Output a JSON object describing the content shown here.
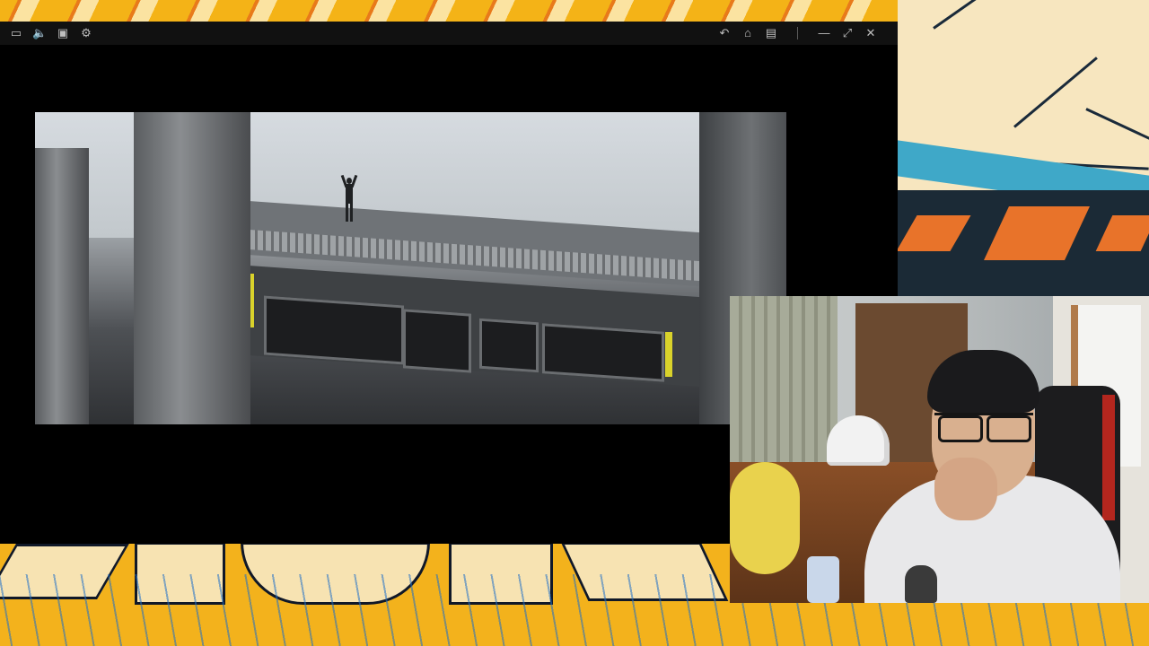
{
  "player": {
    "left_controls": [
      {
        "name": "screen-mode-icon",
        "glyph": "▭"
      },
      {
        "name": "volume-icon",
        "glyph": "🔈"
      },
      {
        "name": "subtitle-icon",
        "glyph": "▣"
      },
      {
        "name": "settings-gear-icon",
        "glyph": "⚙"
      }
    ],
    "right_controls": [
      {
        "name": "rotate-back-icon",
        "glyph": "↶"
      },
      {
        "name": "home-icon",
        "glyph": "⌂"
      },
      {
        "name": "layout-icon",
        "glyph": "▤"
      },
      {
        "name": "minimize-icon",
        "glyph": "—"
      },
      {
        "name": "fullscreen-icon",
        "glyph": "⤢"
      },
      {
        "name": "close-icon",
        "glyph": "✕"
      }
    ]
  },
  "colors": {
    "window_bg": "#000000",
    "titlebar_bg": "#111111",
    "icon_color": "#bfbfbf",
    "background_yellow": "#f3b21c"
  }
}
